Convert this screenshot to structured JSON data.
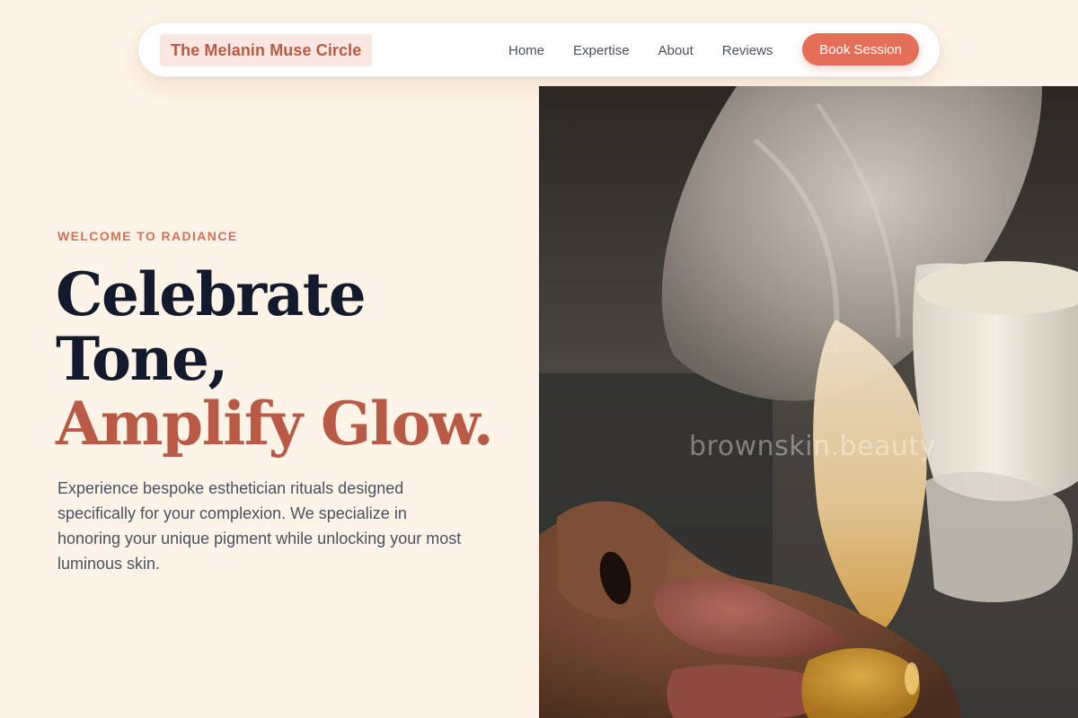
{
  "nav": {
    "brand": "The Melanin Muse Circle",
    "links": [
      {
        "label": "Home"
      },
      {
        "label": "Expertise"
      },
      {
        "label": "About"
      },
      {
        "label": "Reviews"
      }
    ],
    "cta_label": "Book Session"
  },
  "hero": {
    "eyebrow": "WELCOME TO RADIANCE",
    "headline_line1": "Celebrate",
    "headline_line2": "Tone,",
    "headline_line3": "Amplify Glow.",
    "description": "Experience bespoke esthetician rituals designed specifically for your complexion. We specialize in honoring your unique pigment while unlocking your most luminous skin.",
    "image_watermark": "brownskin.beauty"
  },
  "colors": {
    "background": "#fdf3e6",
    "accent": "#e46e58",
    "accent_dark": "#b85a45",
    "ink": "#141a2e"
  }
}
